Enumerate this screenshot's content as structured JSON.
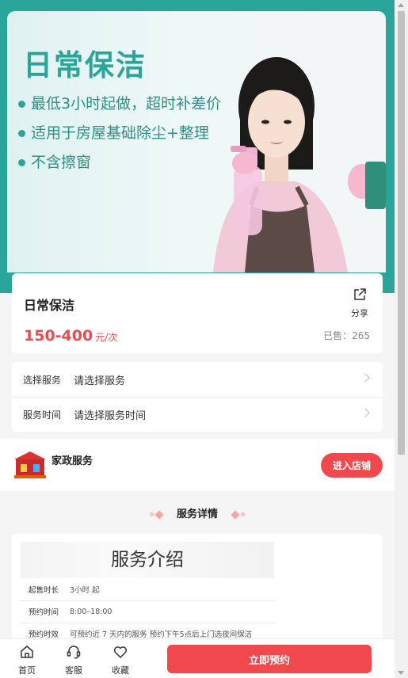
{
  "banner": {
    "title": "日常保洁",
    "points": [
      "最低3小时起做，超时补差价",
      "适用于房屋基础除尘+整理",
      "不含擦窗"
    ]
  },
  "product": {
    "name": "日常保洁",
    "share_label": "分享",
    "price_range": "150-400",
    "price_unit": "元/次",
    "sold": "已售：265"
  },
  "options": [
    {
      "label": "选择服务",
      "value": "请选择服务"
    },
    {
      "label": "服务时间",
      "value": "请选择服务时间"
    }
  ],
  "shop": {
    "name": "家政服务",
    "enter_label": "进入店铺"
  },
  "details": {
    "section_title": "服务详情",
    "intro_title": "服务介绍",
    "rows": [
      {
        "key": "起售时长",
        "value": "3小时 起"
      },
      {
        "key": "预约时间",
        "value": "8:00–18:00"
      },
      {
        "key": "预约时效",
        "value": "可预约近 7 天内的服务   预约下午5点后上门选夜间保洁"
      }
    ]
  },
  "bottom_bar": {
    "home": "首页",
    "service": "客服",
    "favorite": "收藏",
    "book": "立即预约"
  },
  "colors": {
    "accent": "#f0484d",
    "banner": "#2aa59a"
  }
}
